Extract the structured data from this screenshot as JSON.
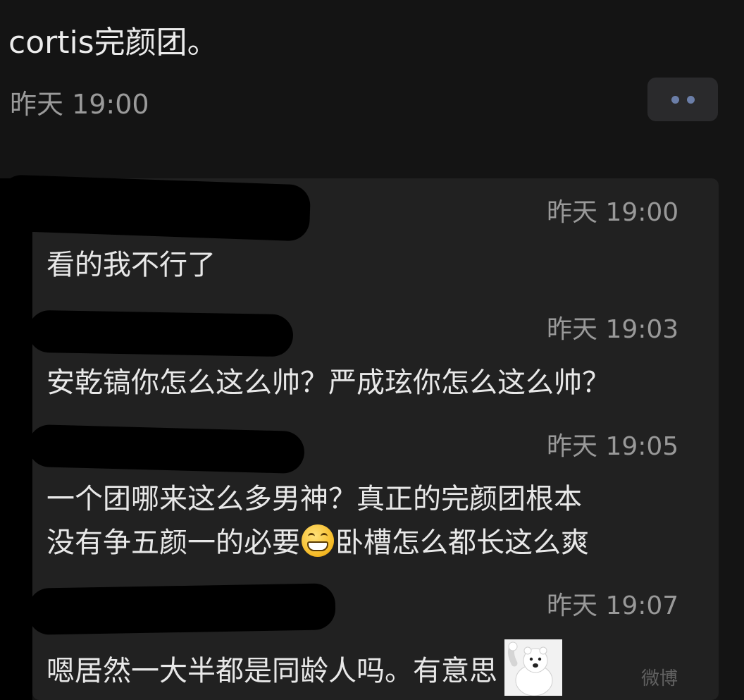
{
  "post": {
    "title": "cortis完颜团。",
    "time": "昨天 19:00"
  },
  "more_button": {
    "icon": "more-dots-icon",
    "accent": "#6b7ea8"
  },
  "comments": [
    {
      "time": "昨天 19:00",
      "lines": [
        "看的我不行了"
      ]
    },
    {
      "time": "昨天 19:03",
      "lines": [
        "安乾镐你怎么这么帅？严成玹你怎么这么帅？"
      ]
    },
    {
      "time": "昨天 19:05",
      "line1": "一个团哪来这么多男神？真正的完颜团根本",
      "line2_before": "没有争五颜一的必要",
      "line2_emoji": "grinning-face-emoji",
      "line2_after": "卧槽怎么都长这么爽"
    },
    {
      "time": "昨天 19:07",
      "text": "嗯居然一大半都是同龄人吗。有意思",
      "sticker": "polar-bear-sticker"
    }
  ],
  "watermark": "微博"
}
